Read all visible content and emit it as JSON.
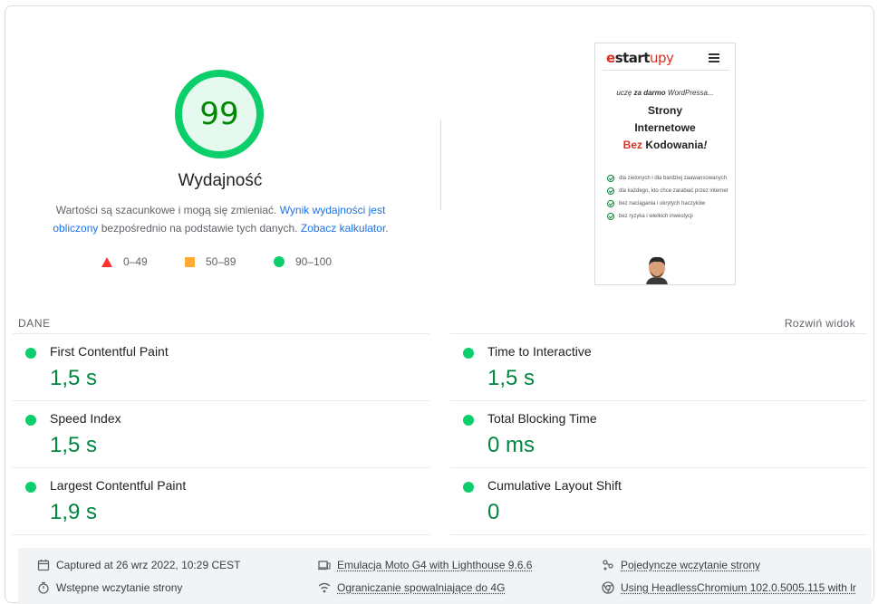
{
  "summary": {
    "score": "99",
    "score_fraction": 0.99,
    "title": "Wydajność",
    "desc_part1": "Wartości są szacunkowe i mogą się zmieniać. ",
    "desc_link1": "Wynik wydajności jest obliczony",
    "desc_part2": " bezpośrednio na podstawie tych danych. ",
    "desc_link2": "Zobacz kalkulator",
    "desc_part3": ".",
    "legend": [
      {
        "label": "0–49",
        "color": "#ff3333"
      },
      {
        "label": "50–89",
        "color": "#ffaa33"
      },
      {
        "label": "90–100",
        "color": "#0cce6b"
      }
    ]
  },
  "thumbnail": {
    "logo_e": "e",
    "logo_start": "start",
    "logo_upy": "upy",
    "tag_pre": "uczę ",
    "tag_bold": "za darmo",
    "tag_post": " WordPressa...",
    "h1_line1": "Strony",
    "h1_line2": "Internetowe",
    "h1_red": "Bez",
    "h1_rest": " Kodowania",
    "h1_mark": "!",
    "bullets": [
      "dla zielonych i dla bardziej zaawansowanych",
      "dla każdego, kto chce zarabiać przez internet",
      "bez naciągania i ukrytych haczyków",
      "bez ryzyka i wielkich inwestycji"
    ]
  },
  "metrics_header": {
    "label": "DANE",
    "expand": "Rozwiń widok"
  },
  "metrics": [
    {
      "name": "First Contentful Paint",
      "value": "1,5 s"
    },
    {
      "name": "Time to Interactive",
      "value": "1,5 s"
    },
    {
      "name": "Speed Index",
      "value": "1,5 s"
    },
    {
      "name": "Total Blocking Time",
      "value": "0 ms"
    },
    {
      "name": "Largest Contentful Paint",
      "value": "1,9 s"
    },
    {
      "name": "Cumulative Layout Shift",
      "value": "0"
    }
  ],
  "footer": {
    "captured": "Captured at 26 wrz 2022, 10:29 CEST",
    "emulation": "Emulacja Moto G4 with Lighthouse 9.6.6",
    "single_load": "Pojedyncze wczytanie strony",
    "initial_load": "Wstępne wczytanie strony",
    "throttling": "Ograniczanie spowalniające do 4G",
    "browser": "Using HeadlessChromium 102.0.5005.115 with lr"
  },
  "colors": {
    "pass": "#0cce6b",
    "pass_text": "#018642",
    "link": "#1a73e8"
  }
}
